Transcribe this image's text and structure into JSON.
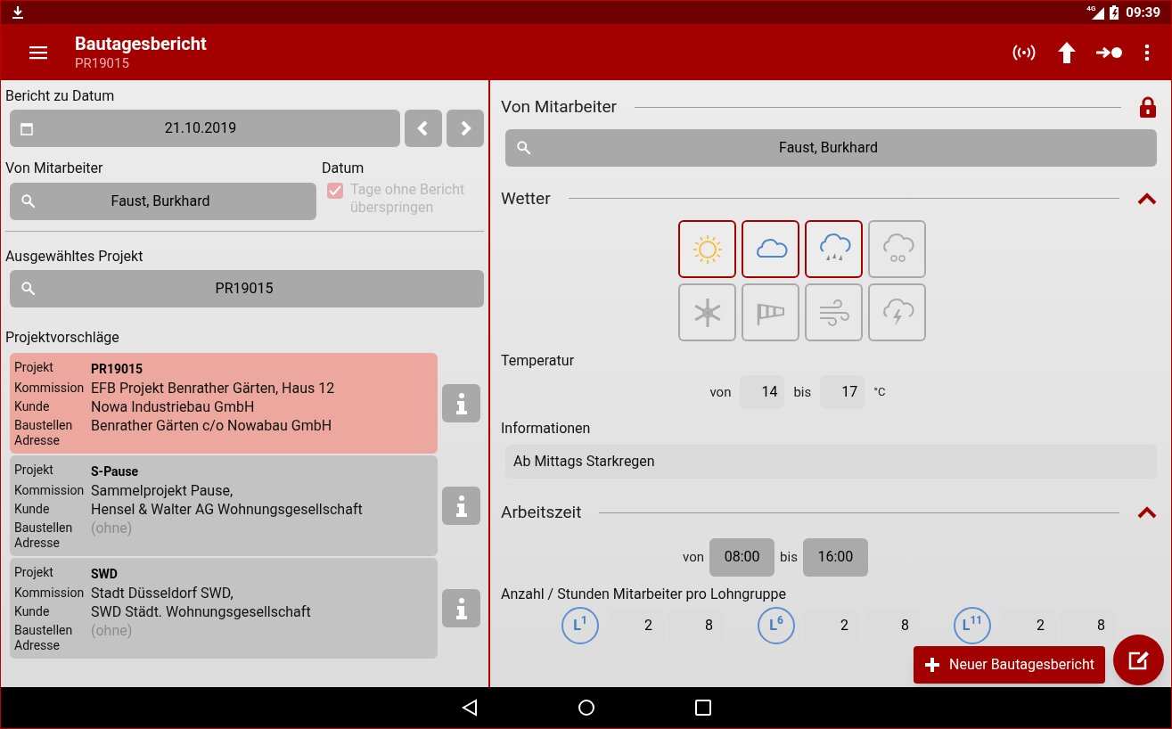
{
  "status_bar": {
    "network": "4G",
    "time": "09:39"
  },
  "app_bar": {
    "title": "Bautagesbericht",
    "subtitle": "PR19015"
  },
  "left": {
    "date_label": "Bericht zu Datum",
    "date": "21.10.2019",
    "employee_label": "Von Mitarbeiter",
    "employee": "Faust, Burkhard",
    "datum_label": "Datum",
    "skip_days": {
      "label": "Tage ohne Bericht überspringen",
      "checked": true,
      "disabled": true
    },
    "project_label": "Ausgewähltes Projekt",
    "project": "PR19015",
    "suggestions_label": "Projektvorschläge",
    "suggestions": [
      {
        "selected": true,
        "rows": [
          {
            "label": "Projekt",
            "value": "PR19015",
            "kind": "bold"
          },
          {
            "label": "Kommission",
            "value": "EFB Projekt Benrather Gärten, Haus 12",
            "kind": "text"
          },
          {
            "label": "Kunde",
            "value": "Nowa Industriebau GmbH",
            "kind": "text"
          },
          {
            "label": "Baustellen Adresse",
            "value": "Benrather Gärten c/o Nowabau GmbH",
            "kind": "text"
          }
        ]
      },
      {
        "selected": false,
        "rows": [
          {
            "label": "Projekt",
            "value": "S-Pause",
            "kind": "bold"
          },
          {
            "label": "Kommission",
            "value": "Sammelprojekt Pause,",
            "kind": "text"
          },
          {
            "label": "Kunde",
            "value": "Hensel & Walter AG Wohnungsgesellschaft",
            "kind": "text"
          },
          {
            "label": "Baustellen Adresse",
            "value": "(ohne)",
            "kind": "muted"
          }
        ]
      },
      {
        "selected": false,
        "rows": [
          {
            "label": "Projekt",
            "value": "SWD",
            "kind": "bold"
          },
          {
            "label": "Kommission",
            "value": "Stadt Düsseldorf SWD,",
            "kind": "text"
          },
          {
            "label": "Kunde",
            "value": "SWD Städt. Wohnungsgesellschaft",
            "kind": "text"
          },
          {
            "label": "Baustellen Adresse",
            "value": "(ohne)",
            "kind": "muted"
          }
        ]
      }
    ]
  },
  "right": {
    "employee_heading": "Von Mitarbeiter",
    "locked": true,
    "employee": "Faust, Burkhard",
    "weather_heading": "Wetter",
    "weather_expanded": true,
    "weather": [
      {
        "kind": "sun",
        "selected": true
      },
      {
        "kind": "cloud",
        "selected": true
      },
      {
        "kind": "rain",
        "selected": true
      },
      {
        "kind": "snowcloud",
        "selected": false
      },
      {
        "kind": "snowflake",
        "selected": false
      },
      {
        "kind": "windsock",
        "selected": false
      },
      {
        "kind": "wind",
        "selected": false
      },
      {
        "kind": "thunder",
        "selected": false
      }
    ],
    "temperature": {
      "label": "Temperatur",
      "from_label": "von",
      "from": "14",
      "to_label": "bis",
      "to": "17",
      "unit": "°C"
    },
    "info": {
      "label": "Informationen",
      "value": "Ab Mittags Starkregen"
    },
    "worktime_heading": "Arbeitszeit",
    "worktime_expanded": true,
    "worktime": {
      "from_label": "von",
      "from": "08:00",
      "to_label": "bis",
      "to": "16:00"
    },
    "wage_label": "Anzahl / Stunden Mitarbeiter pro Lohngruppe",
    "wage_groups": [
      {
        "badge": "L$^{1}$",
        "count": "2",
        "hours": "8"
      },
      {
        "badge": "L$^{6}$",
        "count": "2",
        "hours": "8"
      },
      {
        "badge": "L$^{11}$",
        "count": "2",
        "hours": "8"
      }
    ]
  },
  "fab": {
    "label": "Neuer Bautagesbericht"
  }
}
